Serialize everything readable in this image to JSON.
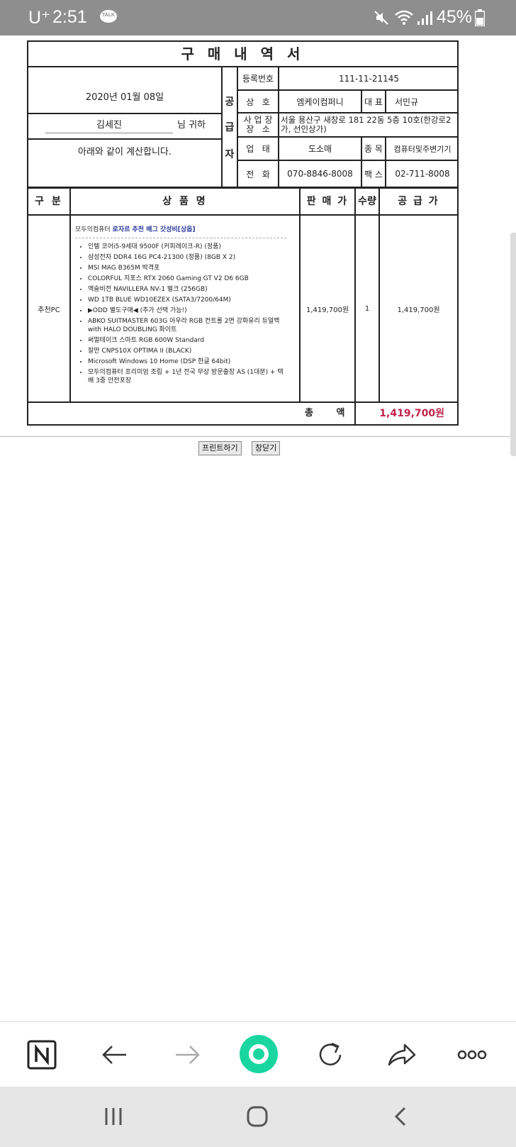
{
  "status_bar": {
    "carrier": "U⁺",
    "time": "2:51",
    "talk_badge": "TALK",
    "battery": "45%",
    "icons": [
      "kakaotalk-icon",
      "mute-icon",
      "wifi-icon",
      "signal-icon",
      "battery-icon"
    ]
  },
  "receipt": {
    "title": "구 매 내 역 서",
    "date": "2020년 01월 08일",
    "buyer_name": "김세진",
    "buyer_honorific": "님 귀하",
    "note": "아래와 같이 계산합니다.",
    "supplier_label": [
      "공",
      "급",
      "자"
    ],
    "supplier": {
      "reg_no_label": "등록번호",
      "reg_no": "111-11-21145",
      "company_label": "상   호",
      "company": "엠케이컴퍼니",
      "ceo_label": "대 표",
      "ceo": "서민규",
      "address_label_1": "사 업 장",
      "address_label_2": "장   소",
      "address": "서울 용산구 새창로 181 22동 5층 10호(한강로2가, 선인상가)",
      "business_type_label": "업   태",
      "business_type": "도소매",
      "item_label": "종 목",
      "item": "컴퓨터및주변기기",
      "phone_label": "전   화",
      "phone": "070-8846-8008",
      "fax_label": "팩 스",
      "fax": "02-711-8008"
    },
    "columns": [
      "구 분",
      "상 품 명",
      "판 매 가",
      "수량",
      "공 급 가"
    ],
    "row": {
      "category": "추천PC",
      "shop": "모두의컴퓨터 ",
      "product_link": "로자르 추천 배그 갓성비[상옵]",
      "items": [
        "인텔 코어i5-9세대 9500F (커피레이크-R) (정품)",
        "삼성전자 DDR4 16G PC4-21300 (정품) (8GB X 2)",
        "MSI MAG B365M 박격포",
        "COLORFUL 지포스 RTX 2060 Gaming GT V2 D6 6GB",
        "엑슬비전 NAVILLERA NV-1 벌크 (256GB)",
        "WD 1TB BLUE WD10EZEX (SATA3/7200/64M)",
        "▶ODD 별도구매◀ (추가 선택 가능!)",
        "ABKO SUITMASTER 603G 아우라 RGB 컨트롤 2면 강화유리 듀얼백 with HALO DOUBLING 화이트",
        "써멀테이크 스마트 RGB 600W Standard",
        "잘만 CNPS10X OPTIMA II (BLACK)",
        "Microsoft Windows 10 Home (DSP 한글 64bit)",
        "모두의컴퓨터 프리미엄 조립 + 1년 전국 무상 방문출장 AS (1대분) + 택배 3중 안전포장"
      ],
      "price": "1,419,700원",
      "qty": "1",
      "supply": "1,419,700원"
    },
    "total_label": "총 액",
    "total": "1,419,700원"
  },
  "buttons": {
    "print": "프린트하기",
    "close": "창닫기"
  },
  "browser_toolbar": [
    "naver-home-icon",
    "back-arrow-icon",
    "forward-arrow-icon",
    "green-search-icon",
    "refresh-icon",
    "share-icon",
    "more-icon"
  ],
  "colors": {
    "status_bar": "#8e8e8e",
    "total_red": "#c0224a",
    "link_blue": "#2a3a9a",
    "green_button": "#19d6a0"
  }
}
